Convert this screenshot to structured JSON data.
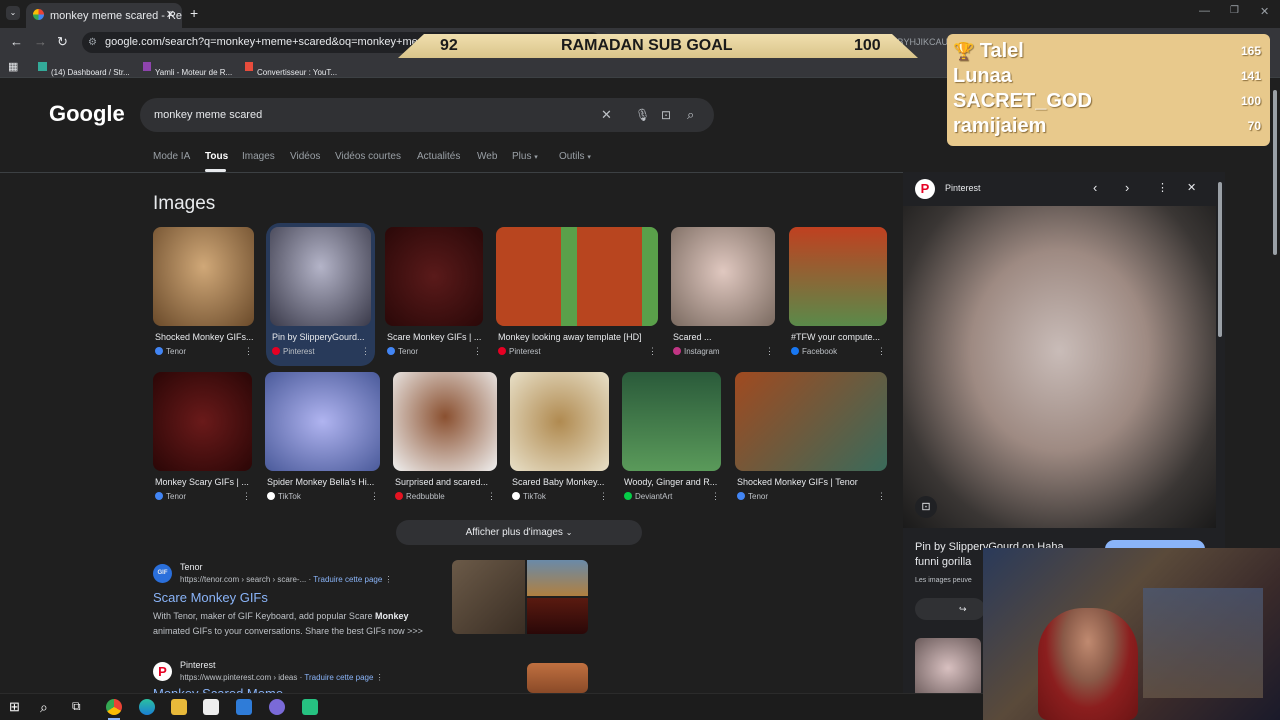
{
  "browser": {
    "tab_title": "monkey meme scared - Recher",
    "url": "google.com/search?q=monkey+meme+scared&oq=monkey+meme+scare",
    "url_tail": "TGBYHJIKCAU",
    "bookmarks": [
      "(14) Dashboard / Str...",
      "Yamli - Moteur de R...",
      "Convertisseur : YouT..."
    ]
  },
  "overlay": {
    "goal_left": "92",
    "goal_title": "RAMADAN SUB GOAL",
    "goal_right": "100",
    "leaderboard": [
      {
        "name": "Talel",
        "score": "165"
      },
      {
        "name": "Lunaa",
        "score": "141"
      },
      {
        "name": "SACRET_GOD",
        "score": "100"
      },
      {
        "name": "ramijaiem",
        "score": "70"
      }
    ]
  },
  "google": {
    "logo": "Google",
    "query": "monkey meme scared",
    "tabs": [
      "Mode IA",
      "Tous",
      "Images",
      "Vidéos",
      "Vidéos courtes",
      "Actualités",
      "Web",
      "Plus",
      "Outils"
    ],
    "images_heading": "Images",
    "show_more": "Afficher plus d'images"
  },
  "images": [
    {
      "caption": "Shocked Monkey GIFs...",
      "source": "Tenor",
      "color": "#4285f4"
    },
    {
      "caption": "Pin by SlipperyGourd...",
      "source": "Pinterest",
      "color": "#e60023"
    },
    {
      "caption": "Scare Monkey GIFs | ...",
      "source": "Tenor",
      "color": "#4285f4"
    },
    {
      "caption": "Monkey looking away template [HD]",
      "source": "Pinterest",
      "color": "#e60023"
    },
    {
      "caption": "Scared ...",
      "source": "Instagram",
      "color": "#c13584"
    },
    {
      "caption": "#TFW your compute...",
      "source": "Facebook",
      "color": "#1877f2"
    },
    {
      "caption": "Monkey Scary GIFs | ...",
      "source": "Tenor",
      "color": "#4285f4"
    },
    {
      "caption": "Spider Monkey Bella's Hi...",
      "source": "TikTok",
      "color": "#ffffff"
    },
    {
      "caption": "Surprised and scared...",
      "source": "Redbubble",
      "color": "#e41321"
    },
    {
      "caption": "Scared Baby Monkey...",
      "source": "TikTok",
      "color": "#ffffff"
    },
    {
      "caption": "Woody, Ginger and R...",
      "source": "DeviantArt",
      "color": "#05cc47"
    },
    {
      "caption": "Shocked Monkey GIFs | Tenor",
      "source": "Tenor",
      "color": "#4285f4"
    }
  ],
  "results": [
    {
      "site": "Tenor",
      "url": "https://tenor.com › search › scare-...",
      "translate": "Traduire cette page",
      "title": "Scare Monkey GIFs",
      "body1": "With Tenor, maker of GIF Keyboard, add popular Scare",
      "bold": "Monkey",
      "body2": "animated GIFs to your conversations. Share the best GIFs now >>>"
    },
    {
      "site": "Pinterest",
      "url": "https://www.pinterest.com › ideas",
      "translate": "Traduire cette page",
      "title": "Monkey Scared Meme"
    }
  ],
  "side_panel": {
    "source": "Pinterest",
    "title": "Pin by SlipperyGourd on Haha funni gorilla",
    "note": "Les images peuve"
  }
}
